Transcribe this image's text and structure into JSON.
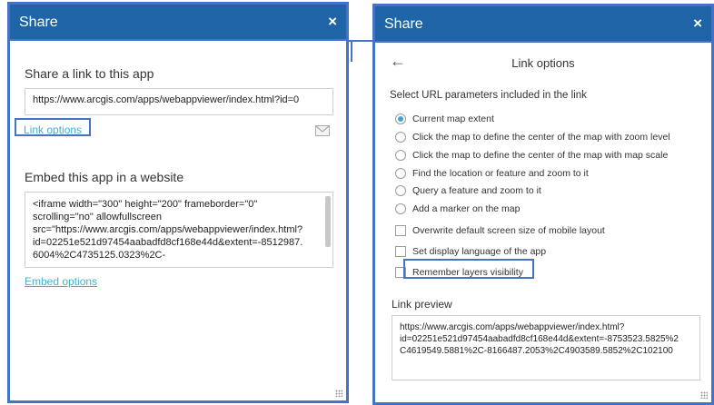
{
  "left": {
    "header_title": "Share",
    "close_glyph": "×",
    "share_link_heading": "Share a link to this app",
    "share_url": "https://www.arcgis.com/apps/webappviewer/index.html?id=0",
    "link_options_label": "Link options",
    "embed_heading": "Embed this app in a website",
    "embed_code_lines": [
      "<iframe width=\"300\" height=\"200\" frameborder=\"0\"",
      "scrolling=\"no\" allowfullscreen",
      "src=\"https://www.arcgis.com/apps/webappviewer/index.html?",
      "id=02251e521d97454aabadfd8cf168e44d&extent=-8512987.",
      "6004%2C4735125.0323%2C-"
    ],
    "embed_options_label": "Embed options",
    "email_icon": "envelope-icon"
  },
  "right": {
    "header_title": "Share",
    "close_glyph": "×",
    "back_glyph": "←",
    "page_title": "Link options",
    "params_heading": "Select URL parameters included in the link",
    "radio_options": [
      "Current map extent",
      "Click the map to define the center of the map with zoom level",
      "Click the map to define the center of the map with map scale",
      "Find the location or feature and zoom to it",
      "Query a feature and zoom to it",
      "Add a marker on the map"
    ],
    "radio_selected": 0,
    "checkbox_options": [
      "Overwrite default screen size of mobile layout",
      "Set display language of the app",
      "Remember layers visibility"
    ],
    "preview_heading": "Link preview",
    "preview_lines": [
      "https://www.arcgis.com/apps/webappviewer/index.html?",
      "id=02251e521d97454aabadfd8cf168e44d&extent=-8753523.5825%2",
      "C4619549.5881%2C-8166487.2053%2C4903589.5852%2C102100"
    ]
  },
  "colors": {
    "header_bg": "#1e64a6",
    "annotation_blue": "#4472c4",
    "link": "#3fb2d6",
    "radio_selected": "#3fa2d8"
  }
}
